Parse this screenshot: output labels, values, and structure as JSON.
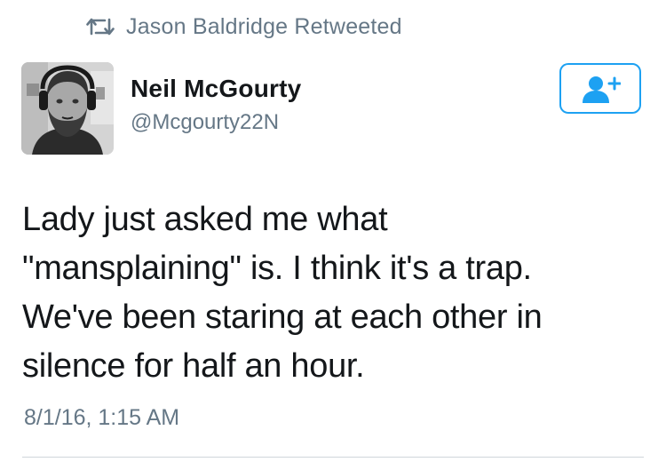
{
  "retweet_banner": {
    "icon": "retweet-icon",
    "text": "Jason Baldridge Retweeted"
  },
  "author": {
    "avatar": "avatar-photo",
    "display_name": "Neil McGourty",
    "handle": "@Mcgourty22N"
  },
  "follow_button": {
    "icon": "add-user-icon",
    "accent_color": "#1da1f2"
  },
  "tweet": {
    "text_lines": [
      "Lady just asked me what",
      "\"mansplaining\" is. I think it's a trap.",
      "We've been staring at each other in",
      "silence for half an hour."
    ],
    "timestamp": "8/1/16, 1:15 AM"
  },
  "colors": {
    "primary_text": "#14171a",
    "secondary_text": "#657786",
    "accent": "#1da1f2",
    "divider": "#cfd6db"
  }
}
